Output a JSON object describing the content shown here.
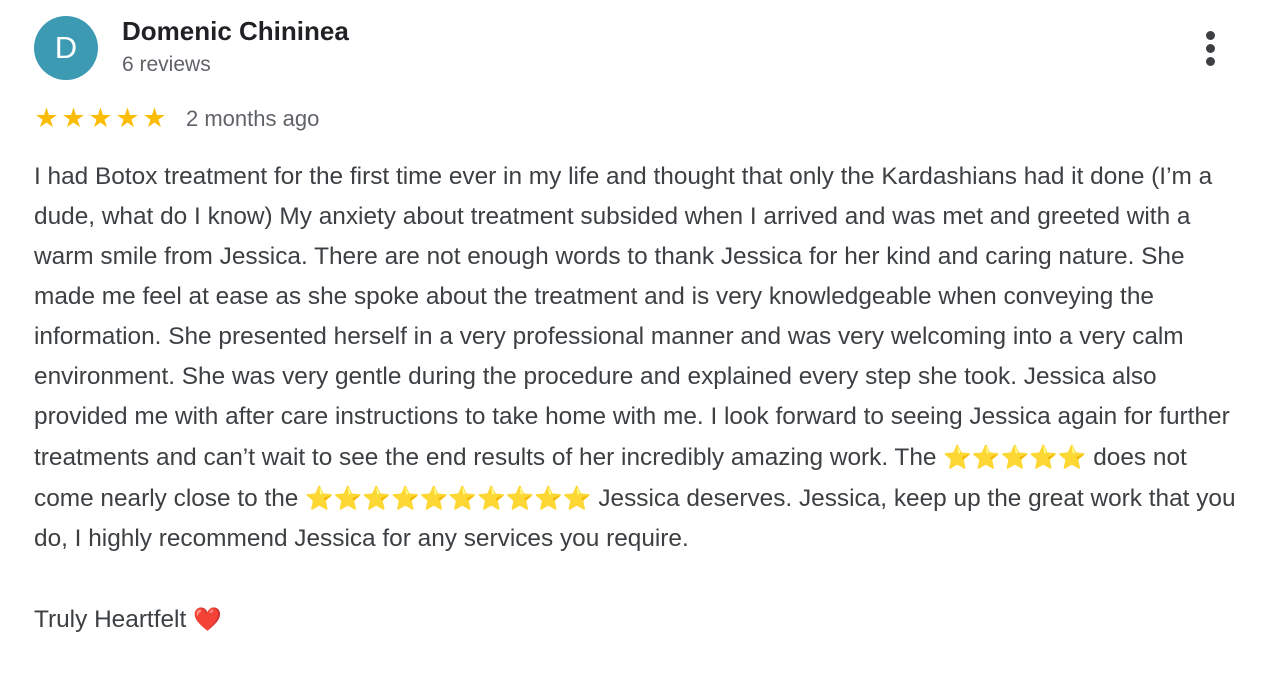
{
  "reviewer": {
    "initial": "D",
    "avatar_color": "#3d9ab3",
    "name": "Domenic Chininea",
    "review_count": "6 reviews"
  },
  "menu_icon": "more-vertical-icon",
  "rating": {
    "value": 5,
    "max": 5,
    "star_color": "#fbbc04",
    "empty_color": "#dadce0"
  },
  "time_ago": "2 months ago",
  "review": {
    "text_part1": "I had Botox treatment for the first time ever in my life and thought that only the Kardashians had it done (I’m a dude, what do I know) My anxiety about treatment subsided when I arrived and was met and greeted with a warm smile from Jessica. There are not enough words to thank Jessica for her kind and caring nature. She made me feel at ease as she spoke about the treatment and is very knowledgeable when conveying the information. She presented herself in a very professional manner and was very welcoming into a very calm environment. She was very gentle during the procedure and explained every step she took. Jessica also provided me with after care instructions to take home with me. I look forward to seeing Jessica again for further treatments and can’t wait to see the end results of her incredibly amazing work. The",
    "stars_emoji_a": "⭐⭐⭐⭐⭐",
    "text_part2": "does not come nearly close to the",
    "stars_emoji_b": "⭐⭐⭐⭐⭐⭐⭐⭐⭐⭐",
    "text_part3": "Jessica deserves. Jessica, keep up the great work that you do, I highly recommend Jessica for any services you require.",
    "signoff": "Truly Heartfelt",
    "signoff_emoji": "❤️"
  }
}
